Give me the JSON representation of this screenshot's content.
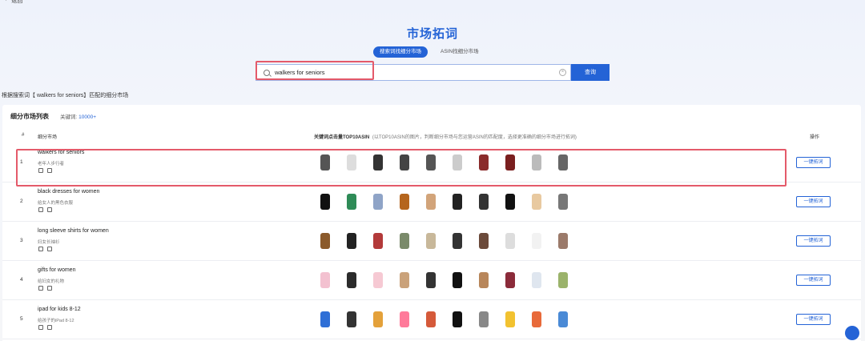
{
  "nav": {
    "back_label": "返回"
  },
  "page_title": "市场拓词",
  "tabs": [
    {
      "label": "搜索词找细分市场",
      "active": true
    },
    {
      "label": "ASIN找细分市场",
      "active": false
    }
  ],
  "search": {
    "value": "walkers for seniors",
    "button_label": "查询"
  },
  "match_text": "根据搜索词【 walkers for seniors】匹配的细分市场",
  "panel": {
    "title": "细分市场列表",
    "keyword_label": "关键词:",
    "keyword_count": "10000+"
  },
  "table": {
    "headers": {
      "index": "#",
      "market": "细分市场",
      "images": "关键词点击量TOP10ASIN",
      "images_note": "(以TOP10ASIN的图片，判断细分市场与您运营ASIN的匹配度，选择更准确的细分市场进行拓词)",
      "action": "操作"
    },
    "rows": [
      {
        "index": "1",
        "keyword": "walkers for seniors",
        "keyword_cn": "老年人步行者",
        "action_label": "一键拓词",
        "thumb_colors": [
          "#555",
          "#ddd",
          "#333",
          "#444",
          "#555",
          "#ccc",
          "#8a2b2b",
          "#7a1f1f",
          "#bbb",
          "#666"
        ]
      },
      {
        "index": "2",
        "keyword": "black dresses for women",
        "keyword_cn": "给女人的黑色衣服",
        "action_label": "一键拓词",
        "thumb_colors": [
          "#111",
          "#2e8b57",
          "#8fa4c7",
          "#b5651d",
          "#d2a47a",
          "#222",
          "#333",
          "#111",
          "#e8c9a0",
          "#777"
        ]
      },
      {
        "index": "3",
        "keyword": "long sleeve shirts for women",
        "keyword_cn": "妇女长袖衫",
        "action_label": "一键拓词",
        "thumb_colors": [
          "#8b5a2b",
          "#222",
          "#b33a3a",
          "#7a8a6a",
          "#c8b89a",
          "#333",
          "#6b4a3a",
          "#ddd",
          "#f2f2f2",
          "#9b7a6a"
        ]
      },
      {
        "index": "4",
        "keyword": "gifts for women",
        "keyword_cn": "给妇女的礼物",
        "action_label": "一键拓词",
        "thumb_colors": [
          "#f3c1d0",
          "#2b2b2b",
          "#f6c9d3",
          "#caa27a",
          "#333",
          "#111",
          "#b8865a",
          "#8b2b3a",
          "#dfe6ef",
          "#9bb36b"
        ]
      },
      {
        "index": "5",
        "keyword": "ipad for kids 8-12",
        "keyword_cn": "给孩子的iPad 8-12",
        "action_label": "一键拓词",
        "thumb_colors": [
          "#2f6fd6",
          "#333",
          "#e4a13a",
          "#ff7a9a",
          "#d55a3a",
          "#111",
          "#888",
          "#f2c230",
          "#e86a3a",
          "#4a8ad6"
        ]
      }
    ]
  }
}
